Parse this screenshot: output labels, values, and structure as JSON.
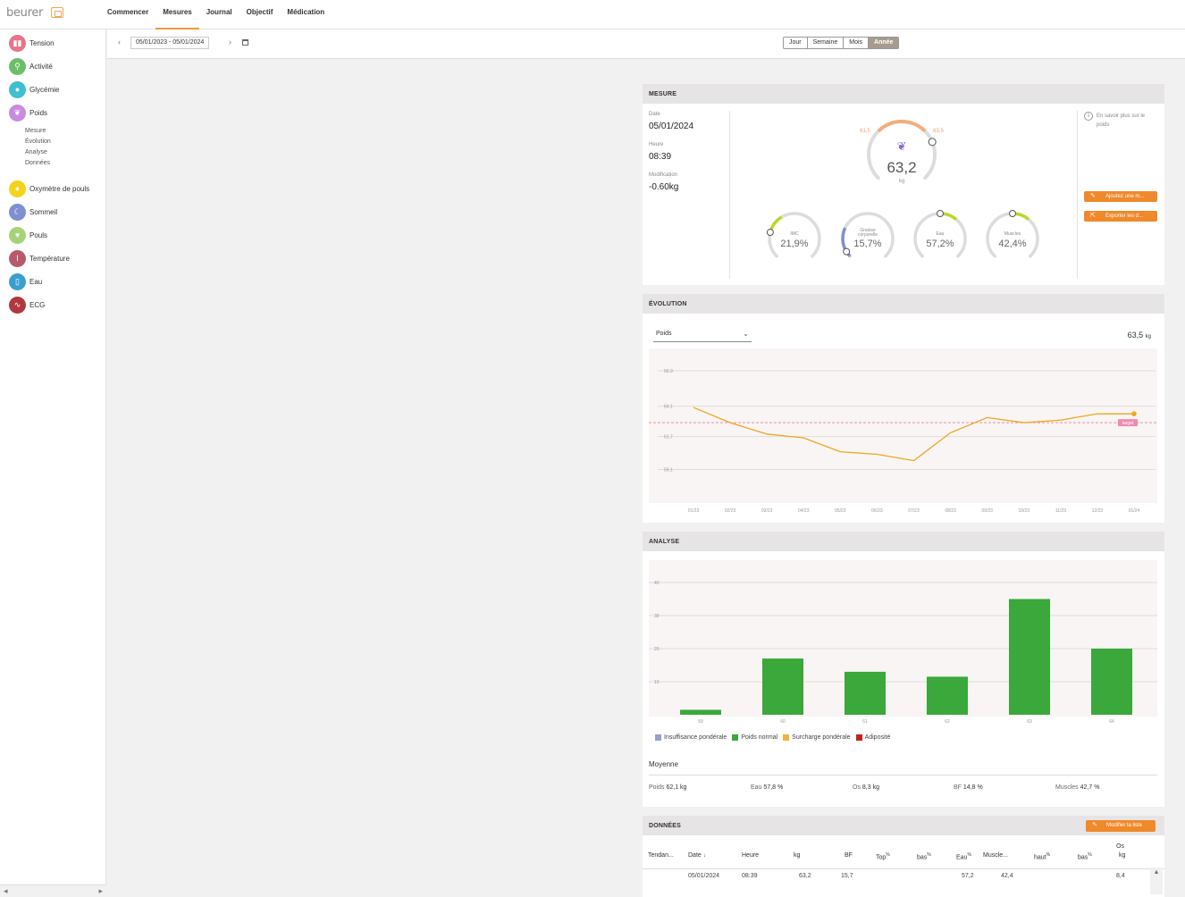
{
  "header": {
    "logo": "beurer",
    "nav": [
      "Commencer",
      "Mesures",
      "Journal",
      "Objectif",
      "Médication"
    ],
    "active_nav": "Mesures"
  },
  "sidebar": {
    "items": [
      {
        "label": "Tension",
        "color": "#e8748a",
        "icon": "blood-pressure-icon"
      },
      {
        "label": "Activité",
        "color": "#6cbf6a",
        "icon": "activity-icon"
      },
      {
        "label": "Glycémie",
        "color": "#3fbfcf",
        "icon": "glucose-drop-icon"
      },
      {
        "label": "Poids",
        "color": "#c98be0",
        "icon": "weight-feather-icon"
      },
      {
        "label": "Oxymètre de pouls",
        "color": "#f5d21e",
        "icon": "oximeter-drop-icon"
      },
      {
        "label": "Sommeil",
        "color": "#7f8fd0",
        "icon": "moon-icon"
      },
      {
        "label": "Pouls",
        "color": "#a8d27a",
        "icon": "heart-icon"
      },
      {
        "label": "Température",
        "color": "#b85a6a",
        "icon": "thermometer-icon"
      },
      {
        "label": "Eau",
        "color": "#3a9fce",
        "icon": "water-glass-icon"
      },
      {
        "label": "ECG",
        "color": "#b0393f",
        "icon": "ecg-wave-icon"
      }
    ],
    "sub_items": [
      "Mesure",
      "Évolution",
      "Analyse",
      "Données"
    ]
  },
  "toolbar": {
    "date_range": "05/01/2023 - 05/01/2024",
    "periods": [
      "Jour",
      "Semaine",
      "Mois",
      "Année"
    ],
    "active_period": "Année"
  },
  "mesure": {
    "title": "MESURE",
    "date_label": "Date",
    "date": "05/01/2024",
    "time_label": "Heure",
    "time": "08:39",
    "mod_label": "Modification",
    "mod": "-0.60kg",
    "weight": "63,2",
    "weight_unit": "kg",
    "range_low": "61,5",
    "range_high": "63,5",
    "weight_fraction": 0.75,
    "gauges": [
      {
        "label": "IMC",
        "value": "21,9%",
        "color": "#b7d92a",
        "fraction": 0.22
      },
      {
        "label": "Graisse corporelle",
        "value": "15,7%",
        "color": "#7f8fd0",
        "fraction": 0.05
      },
      {
        "label": "Eau",
        "value": "57,2%",
        "color": "#b7d92a",
        "fraction": 0.5
      },
      {
        "label": "Muscles",
        "value": "42,4%",
        "color": "#b7d92a",
        "fraction": 0.5
      }
    ],
    "info": "En savoir plus sur le poids",
    "btn_add": "Ajoutez une m...",
    "btn_export": "Exporter les d..."
  },
  "evolution": {
    "title": "ÉVOLUTION",
    "select": "Poids",
    "current": "63,5",
    "current_unit": "kg",
    "target_label": "target"
  },
  "analyse": {
    "title": "ANALYSE",
    "legend": [
      {
        "label": "Insuffisance pondérale",
        "color": "#9aa0c8"
      },
      {
        "label": "Poids normal",
        "color": "#3aa83a"
      },
      {
        "label": "Surcharge pondérale",
        "color": "#f0b43a"
      },
      {
        "label": "Adiposité",
        "color": "#c82020"
      }
    ],
    "avg_title": "Moyenne",
    "averages": [
      {
        "label": "Poids",
        "value": "62,1 kg"
      },
      {
        "label": "Eau",
        "value": "57,8 %"
      },
      {
        "label": "Os",
        "value": "8,3 kg"
      },
      {
        "label": "BF",
        "value": "14,8 %"
      },
      {
        "label": "Muscles",
        "value": "42,7 %"
      }
    ]
  },
  "donnees": {
    "title": "DONNÉES",
    "btn": "Modifier la liste",
    "columns": [
      "Tendan...",
      "Date",
      "Heure",
      "kg",
      "BF",
      "Top",
      "bas",
      "Eau",
      "Muscle...",
      "haut",
      "bas",
      "Os"
    ],
    "col_units": [
      "",
      "",
      "",
      "",
      "",
      "%",
      "%",
      "%",
      "",
      "%",
      "%",
      "kg"
    ],
    "row": [
      "",
      "05/01/2024",
      "08:39",
      "63,2",
      "15,7",
      "",
      "",
      "57,2",
      "42,4",
      "",
      "",
      "8,4"
    ]
  },
  "chart_data": [
    {
      "type": "line",
      "x": [
        "01/23",
        "02/23",
        "03/23",
        "04/23",
        "05/23",
        "06/23",
        "07/23",
        "08/23",
        "09/23",
        "10/23",
        "11/23",
        "12/23",
        "01/24"
      ],
      "series": [
        {
          "name": "Poids",
          "values": [
            64.0,
            62.8,
            61.9,
            61.6,
            60.5,
            60.3,
            59.8,
            62.0,
            63.2,
            62.8,
            63.0,
            63.5,
            63.5
          ]
        }
      ],
      "yticks": [
        "66.9",
        "64.1",
        "61.7",
        "59.1"
      ],
      "target": 62.8,
      "ylim": [
        57.3,
        66.9
      ]
    },
    {
      "type": "bar",
      "categories": [
        "59",
        "60",
        "61",
        "62",
        "63",
        "64"
      ],
      "values": [
        1.5,
        17,
        13,
        11.5,
        35,
        20
      ],
      "yticks": [
        "40",
        "30",
        "20",
        "10"
      ],
      "ylim": [
        0,
        40
      ]
    }
  ]
}
